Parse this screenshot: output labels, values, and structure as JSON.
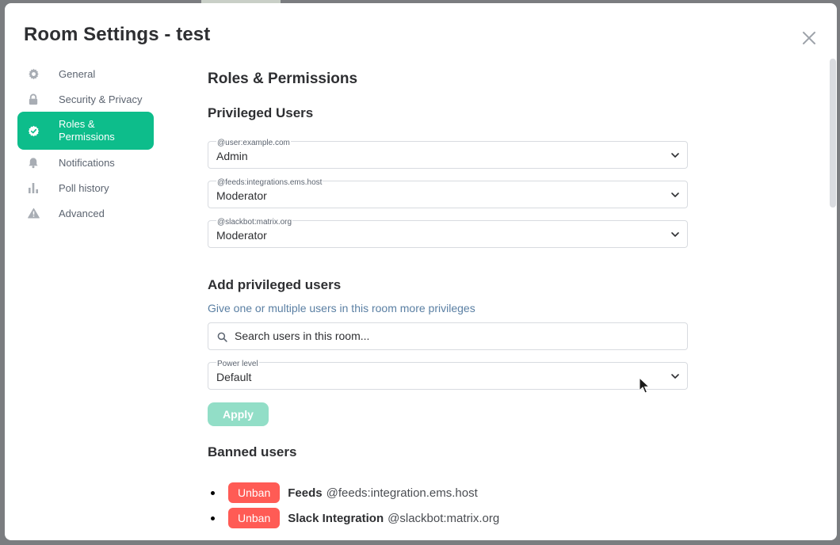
{
  "dialog": {
    "title": "Room Settings - test"
  },
  "sidebar": {
    "items": [
      {
        "label": "General",
        "icon": "gear-icon"
      },
      {
        "label": "Security & Privacy",
        "icon": "lock-icon"
      },
      {
        "label": "Roles &\nPermissions",
        "icon": "shield-check-icon",
        "active": true
      },
      {
        "label": "Notifications",
        "icon": "bell-icon"
      },
      {
        "label": "Poll history",
        "icon": "bar-chart-icon"
      },
      {
        "label": "Advanced",
        "icon": "warning-icon"
      }
    ]
  },
  "main": {
    "heading": "Roles & Permissions",
    "privileged": {
      "heading": "Privileged Users",
      "users": [
        {
          "user_id": "@user:example.com",
          "role": "Admin"
        },
        {
          "user_id": "@feeds:integrations.ems.host",
          "role": "Moderator"
        },
        {
          "user_id": "@slackbot:matrix.org",
          "role": "Moderator"
        }
      ]
    },
    "add": {
      "heading": "Add privileged users",
      "description": "Give one or multiple users in this room more privileges",
      "search_placeholder": "Search users in this room...",
      "power_label": "Power level",
      "power_value": "Default",
      "apply_label": "Apply"
    },
    "banned": {
      "heading": "Banned users",
      "unban_label": "Unban",
      "users": [
        {
          "name": "Feeds",
          "user_id": "@feeds:integration.ems.host"
        },
        {
          "name": "Slack Integration",
          "user_id": "@slackbot:matrix.org"
        }
      ]
    }
  },
  "colors": {
    "accent": "#0dbd8b",
    "apply_disabled": "#92dec7",
    "unban": "#ff5b55",
    "link_text": "#5a7fa3"
  }
}
